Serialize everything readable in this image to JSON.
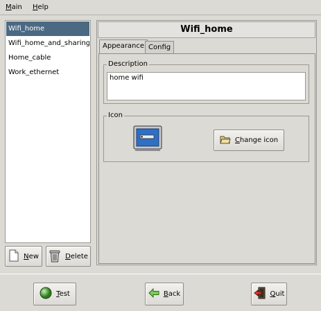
{
  "menubar": {
    "main": "Main",
    "help": "Help"
  },
  "profiles": [
    {
      "label": "Wifi_home",
      "selected": true
    },
    {
      "label": "Wifi_home_and_sharing",
      "selected": false
    },
    {
      "label": "Home_cable",
      "selected": false
    },
    {
      "label": "Work_ethernet",
      "selected": false
    }
  ],
  "list_buttons": {
    "new": "New",
    "delete": "Delete"
  },
  "profile": {
    "title": "Wifi_home",
    "tabs": [
      "Appearance",
      "Config"
    ],
    "active_tab": "Appearance",
    "description_legend": "Description",
    "description_value": "home wifi",
    "icon_legend": "Icon",
    "change_icon": "Change icon"
  },
  "footer": {
    "test": "Test",
    "back": "Back",
    "quit": "Quit"
  },
  "colors": {
    "selection": "#4b6983",
    "background": "#dcdad5"
  }
}
